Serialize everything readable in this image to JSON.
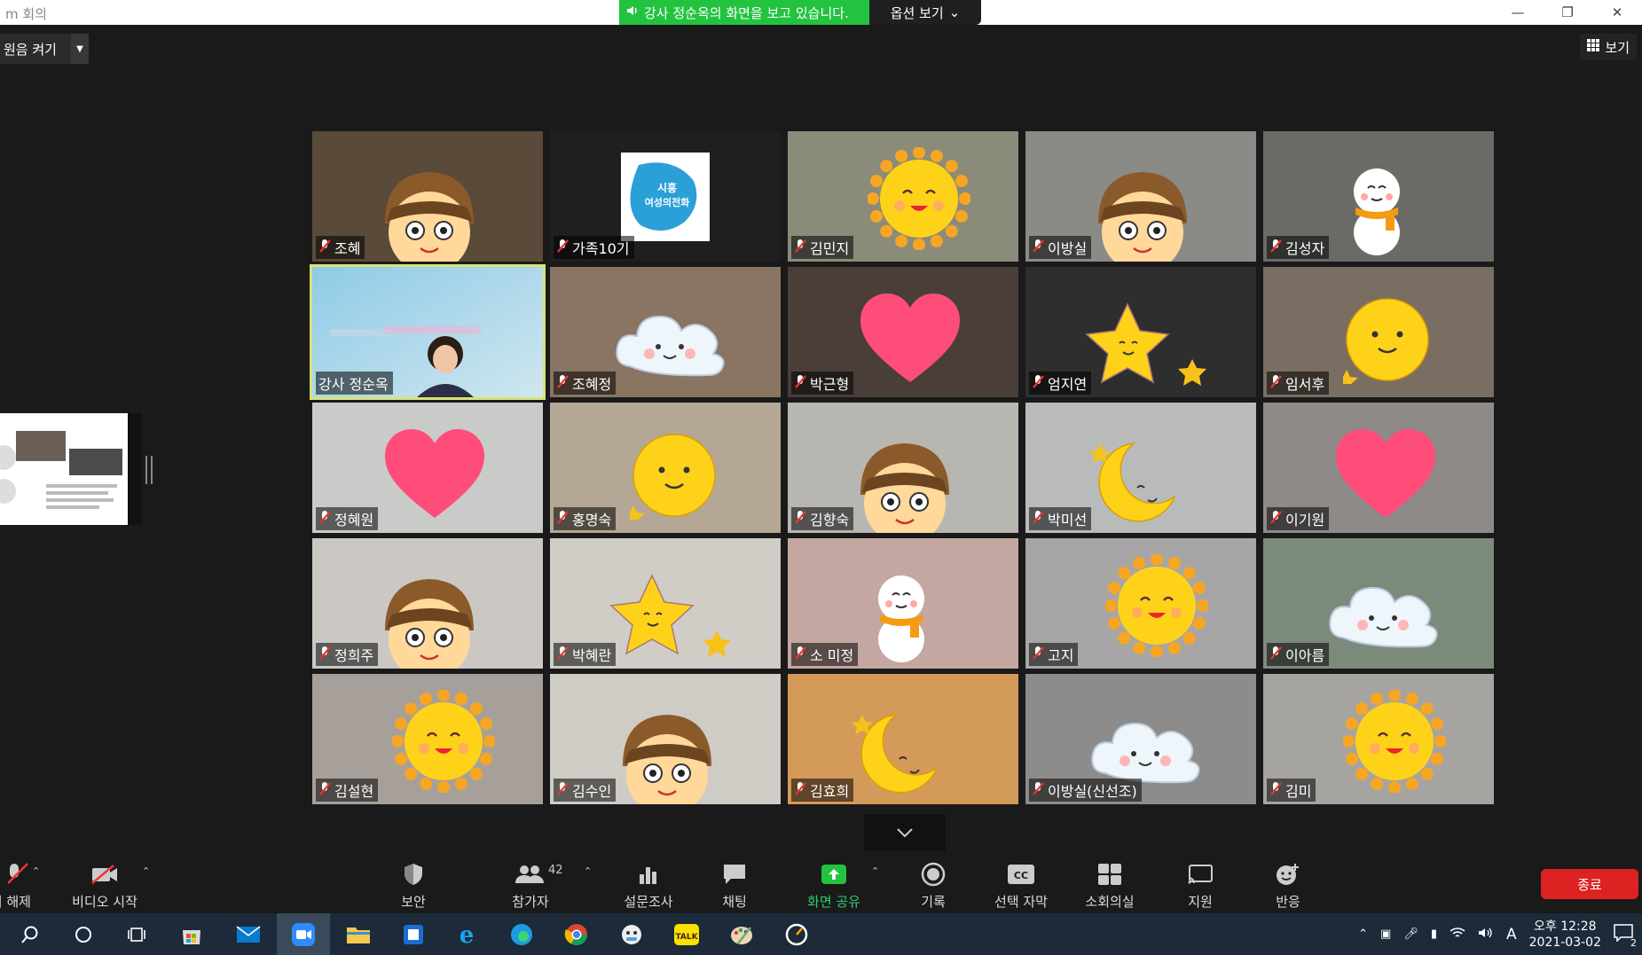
{
  "window": {
    "title": "m 회의"
  },
  "share_banner": {
    "text": "강사 정순옥의 화면을 보고 있습니다.",
    "options_label": "옵션 보기"
  },
  "top_controls": {
    "audio_label": "원음 켜기",
    "view_label": "보기"
  },
  "participants": [
    {
      "name": "조혜",
      "muted": true,
      "sticker": "chestnut",
      "bg": "#5a4a3a"
    },
    {
      "name": "가족10기",
      "muted": true,
      "sticker": "logo",
      "bg": "#1f1f1f"
    },
    {
      "name": "김민지",
      "muted": true,
      "sticker": "sun",
      "bg": "#8b8b7a"
    },
    {
      "name": "이방실",
      "muted": true,
      "sticker": "chestnut",
      "bg": "#8a8a86"
    },
    {
      "name": "김성자",
      "muted": true,
      "sticker": "snowman",
      "bg": "#6c6a66"
    },
    {
      "name": "강사 정순옥",
      "muted": false,
      "sticker": "none",
      "bg": "#9fc6d8",
      "active": true
    },
    {
      "name": "조혜정",
      "muted": true,
      "sticker": "cloud",
      "bg": "#8a7462"
    },
    {
      "name": "박근형",
      "muted": true,
      "sticker": "heart",
      "bg": "#4a3e38"
    },
    {
      "name": "엄지연",
      "muted": true,
      "sticker": "star",
      "bg": "#2e2e2e"
    },
    {
      "name": "임서후",
      "muted": true,
      "sticker": "smiley",
      "bg": "#7a6d62"
    },
    {
      "name": "정혜원",
      "muted": true,
      "sticker": "heart",
      "bg": "#c9cbc9"
    },
    {
      "name": "홍명숙",
      "muted": true,
      "sticker": "smiley",
      "bg": "#b5a796"
    },
    {
      "name": "김향숙",
      "muted": true,
      "sticker": "chestnut",
      "bg": "#b8b6b1"
    },
    {
      "name": "박미선",
      "muted": true,
      "sticker": "moon",
      "bg": "#b8bbb9"
    },
    {
      "name": "이기원",
      "muted": true,
      "sticker": "heart",
      "bg": "#8e8a87"
    },
    {
      "name": "정희주",
      "muted": true,
      "sticker": "chestnut",
      "bg": "#cbc8c4"
    },
    {
      "name": "박혜란",
      "muted": true,
      "sticker": "star",
      "bg": "#d0ccc6"
    },
    {
      "name": "소 미정",
      "muted": true,
      "sticker": "snowman",
      "bg": "#c4a7a0"
    },
    {
      "name": "고지",
      "muted": true,
      "sticker": "sun",
      "bg": "#a8a5a6"
    },
    {
      "name": "이아름",
      "muted": true,
      "sticker": "cloud",
      "bg": "#7c8a7c"
    },
    {
      "name": "김설현",
      "muted": true,
      "sticker": "sun",
      "bg": "#a7a09a"
    },
    {
      "name": "김수인",
      "muted": true,
      "sticker": "chestnut",
      "bg": "#cfccc5"
    },
    {
      "name": "김효희",
      "muted": true,
      "sticker": "moon",
      "bg": "#d49a5a"
    },
    {
      "name": "이방실(신선조)",
      "muted": true,
      "sticker": "cloud",
      "bg": "#8e8c8a"
    },
    {
      "name": "김미",
      "muted": true,
      "sticker": "sun",
      "bg": "#a6a4a1"
    }
  ],
  "toolbar": {
    "unmute_label": "소리 해제",
    "video_label": "비디오 시작",
    "security_label": "보안",
    "participants_label": "참가자",
    "participants_count": "42",
    "polls_label": "설문조사",
    "chat_label": "채팅",
    "share_label": "화면 공유",
    "record_label": "기록",
    "cc_label": "선택 자막",
    "breakout_label": "소회의실",
    "support_label": "지원",
    "reactions_label": "반응",
    "end_label": "종료"
  },
  "taskbar": {
    "time": "오후 12:28",
    "date": "2021-03-02",
    "ime": "A",
    "notif_count": "2"
  },
  "colors": {
    "share_green": "#23c340",
    "end_red": "#dd2222",
    "active_border": "#d8e37a",
    "sticker_yellow": "#ffd21a"
  }
}
